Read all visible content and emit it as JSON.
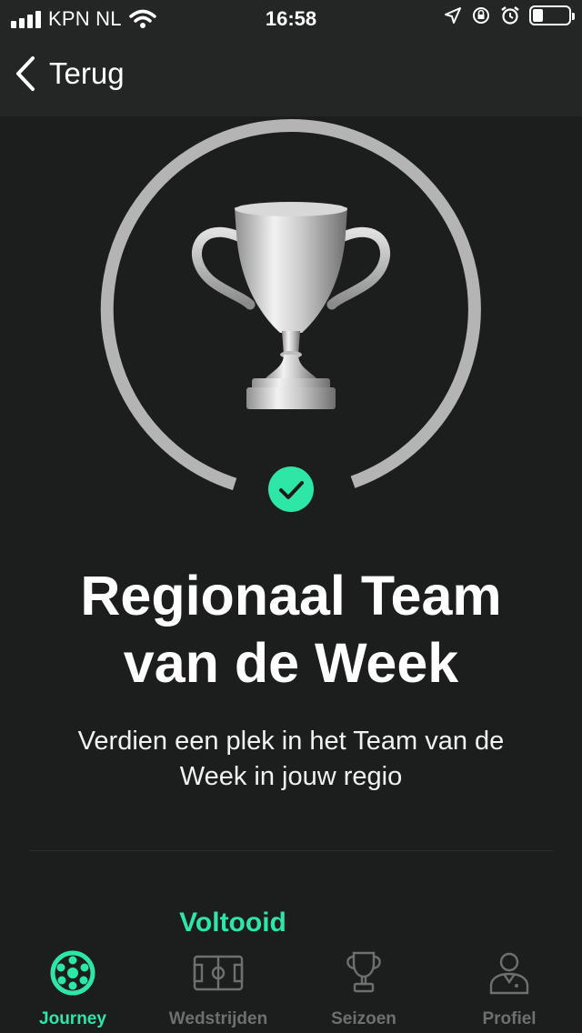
{
  "status_bar": {
    "carrier": "KPN NL",
    "time": "16:58"
  },
  "nav": {
    "back_label": "Terug"
  },
  "achievement": {
    "title_line1": "Regionaal Team",
    "title_line2": "van de Week",
    "description_line1": "Verdien een plek in het Team van de",
    "description_line2": "Week in jouw regio",
    "status": "Voltooid",
    "progress": 1.0
  },
  "tabs": [
    {
      "label": "Journey",
      "icon": "soccer-ball-icon",
      "active": true
    },
    {
      "label": "Wedstrijden",
      "icon": "pitch-icon",
      "active": false
    },
    {
      "label": "Seizoen",
      "icon": "trophy-icon",
      "active": false
    },
    {
      "label": "Profiel",
      "icon": "player-icon",
      "active": false
    }
  ],
  "colors": {
    "accent": "#2ee6a6",
    "background": "#1c1d1d",
    "header": "#242525",
    "inactive": "#6e6f6f",
    "ring": "#b4b4b4"
  }
}
